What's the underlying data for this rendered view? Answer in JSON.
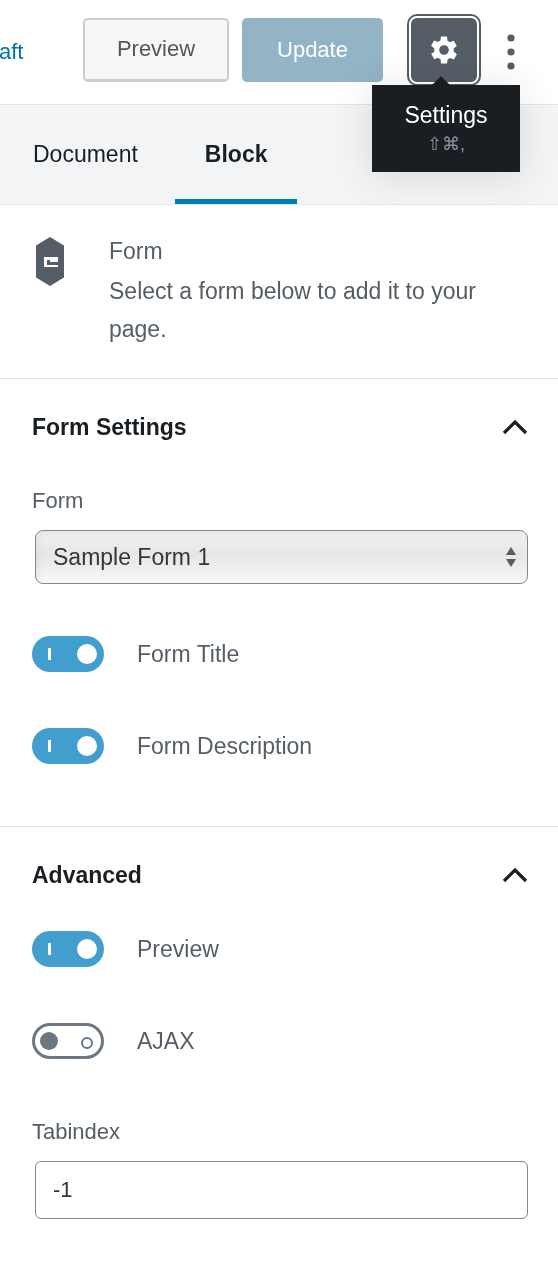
{
  "header": {
    "draft_link": "aft",
    "preview_button": "Preview",
    "update_button": {
      "label": "Update",
      "disabled": true
    },
    "settings_button": {
      "pressed": true
    },
    "tooltip": {
      "title": "Settings",
      "shortcut": "⇧⌘,"
    }
  },
  "tabs": [
    {
      "label": "Document",
      "selected": false
    },
    {
      "label": "Block",
      "selected": true
    }
  ],
  "block": {
    "title": "Form",
    "description": "Select a form below to add it to your page."
  },
  "panels": [
    {
      "title": "Form Settings",
      "expanded": true,
      "controls": [
        {
          "kind": "select",
          "label": "Form",
          "value": "Sample Form 1"
        },
        {
          "kind": "toggle",
          "label": "Form Title",
          "on": true
        },
        {
          "kind": "toggle",
          "label": "Form Description",
          "on": true
        }
      ]
    },
    {
      "title": "Advanced",
      "expanded": true,
      "controls": [
        {
          "kind": "toggle",
          "label": "Preview",
          "on": true
        },
        {
          "kind": "toggle",
          "label": "AJAX",
          "on": false
        },
        {
          "kind": "text",
          "label": "Tabindex",
          "value": "-1"
        }
      ]
    }
  ]
}
